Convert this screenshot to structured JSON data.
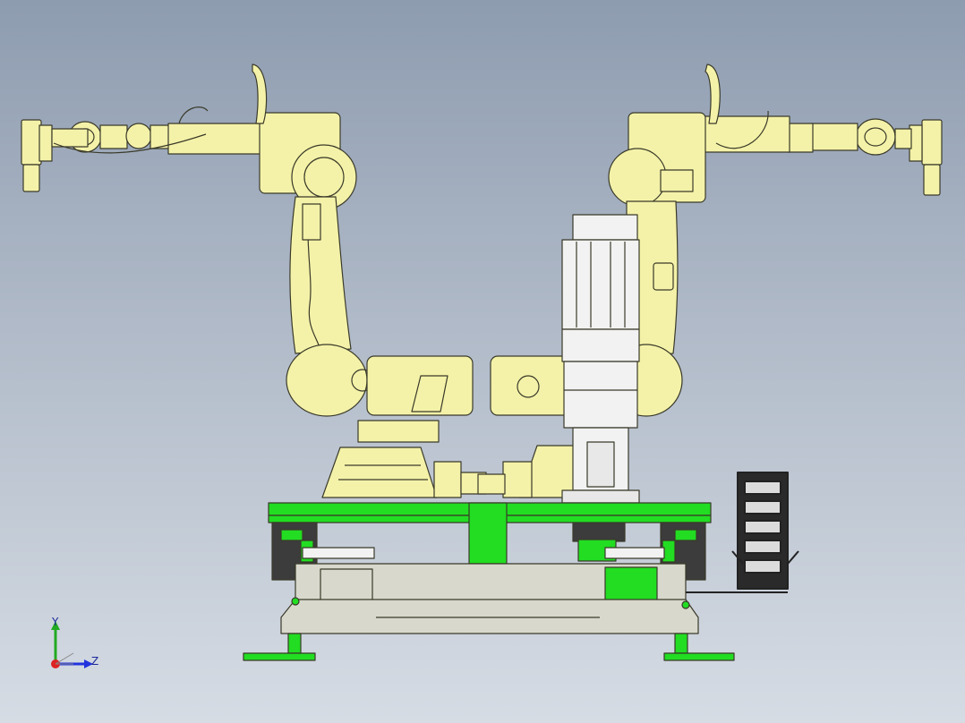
{
  "viewport": {
    "background_top": "#8e9cb0",
    "background_bottom": "#d6dce4"
  },
  "colors": {
    "robot_yellow": "#f4f2a8",
    "robot_outline": "#3a3a2a",
    "frame_green": "#22dd22",
    "base_gray": "#d8d8cc",
    "motor_white": "#f2f2f2",
    "dark_part": "#3c3c3c",
    "axis_x": "#2233dd",
    "axis_y": "#22aa22",
    "axis_z": "#2233dd"
  },
  "triad": {
    "y_label": "Y",
    "z_label": "Z",
    "icon": "coordinate-triad-icon"
  }
}
